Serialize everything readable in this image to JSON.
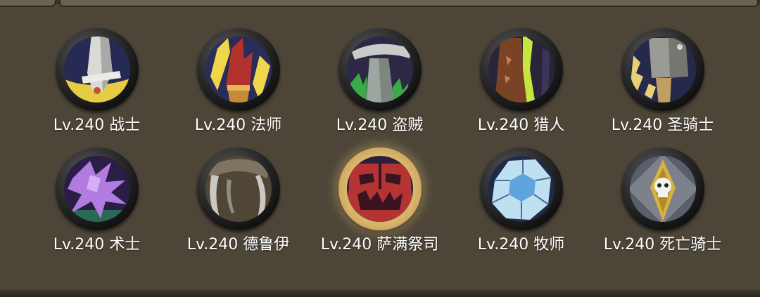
{
  "classes": [
    {
      "label": "Lv.240 战士",
      "icon": "warrior-sword-icon",
      "selected": false
    },
    {
      "label": "Lv.240 法师",
      "icon": "mage-flame-icon",
      "selected": false
    },
    {
      "label": "Lv.240 盗贼",
      "icon": "rogue-dagger-icon",
      "selected": false
    },
    {
      "label": "Lv.240 猎人",
      "icon": "hunter-bow-icon",
      "selected": false
    },
    {
      "label": "Lv.240 圣骑士",
      "icon": "paladin-hammer-icon",
      "selected": false
    },
    {
      "label": "Lv.240 术士",
      "icon": "warlock-fel-icon",
      "selected": false
    },
    {
      "label": "Lv.240 德鲁伊",
      "icon": "druid-claw-icon",
      "selected": false
    },
    {
      "label": "Lv.240 萨满祭司",
      "icon": "shaman-totem-icon",
      "selected": true
    },
    {
      "label": "Lv.240 牧师",
      "icon": "priest-crystal-icon",
      "selected": false
    },
    {
      "label": "Lv.240 死亡骑士",
      "icon": "death-knight-skull-icon",
      "selected": false
    }
  ]
}
